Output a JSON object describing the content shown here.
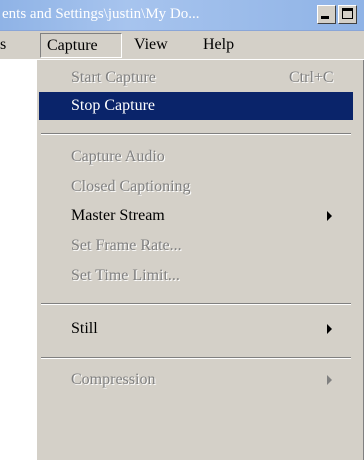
{
  "window": {
    "title": "ents and Settings\\justin\\My Do..."
  },
  "menubar": {
    "left_fragment": "s",
    "capture": "Capture",
    "view": "View",
    "help": "Help"
  },
  "capture_menu": {
    "items": [
      {
        "label": "Start Capture",
        "accelerator": "Ctrl+C",
        "enabled": false
      },
      {
        "label": "Stop Capture",
        "enabled": true,
        "highlighted": true
      },
      {
        "label": "Capture Audio",
        "enabled": false
      },
      {
        "label": "Closed Captioning",
        "enabled": false
      },
      {
        "label": "Master Stream",
        "enabled": true,
        "submenu": true
      },
      {
        "label": "Set Frame Rate...",
        "enabled": false
      },
      {
        "label": "Set Time Limit...",
        "enabled": false
      },
      {
        "label": "Still",
        "enabled": true,
        "submenu": true
      },
      {
        "label": "Compression",
        "enabled": false,
        "submenu": true
      }
    ]
  },
  "colors": {
    "highlight": "#0a246a",
    "menu_bg": "#d4d0c8",
    "disabled_text": "#808080"
  }
}
